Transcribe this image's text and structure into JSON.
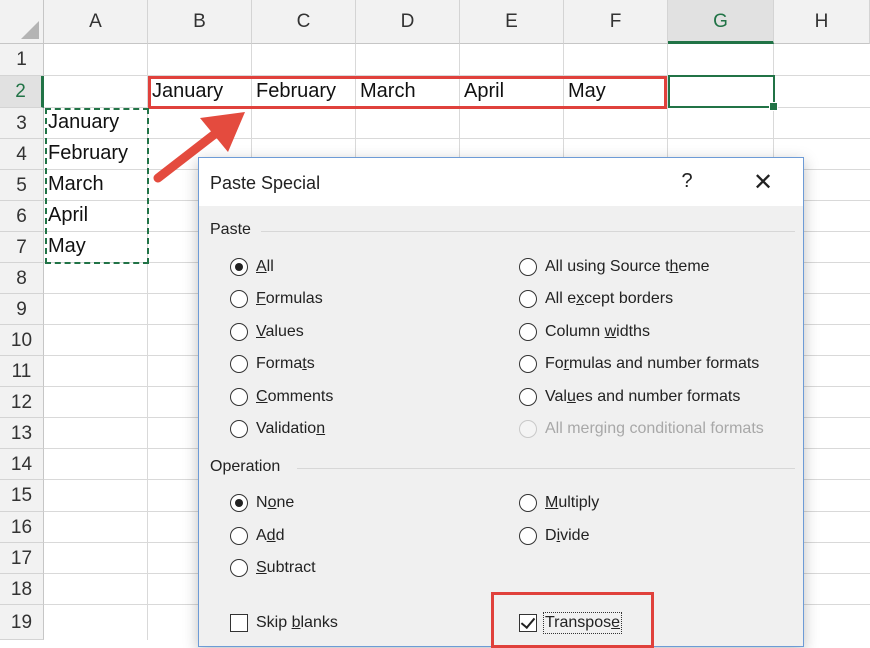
{
  "sheet": {
    "columns": [
      "A",
      "B",
      "C",
      "D",
      "E",
      "F",
      "G",
      "H"
    ],
    "rows": [
      "1",
      "2",
      "3",
      "4",
      "5",
      "6",
      "7",
      "8",
      "9",
      "10",
      "11",
      "12",
      "13",
      "14",
      "15",
      "16",
      "17",
      "18",
      "19"
    ],
    "selected_column": "G",
    "selected_row": "2",
    "row2_cells": [
      "January",
      "February",
      "March",
      "April",
      "May"
    ],
    "columnA_cells": [
      "January",
      "February",
      "March",
      "April",
      "May"
    ],
    "colors": {
      "accent_green": "#217346",
      "highlight_red": "#e0413c",
      "arrow_red": "#e44b3e"
    }
  },
  "dialog": {
    "title": "Paste Special",
    "help_label": "?",
    "close_label": "✕",
    "paste_section": "Paste",
    "paste_left": [
      {
        "pre": "",
        "u": "A",
        "post": "ll",
        "checked": true
      },
      {
        "pre": "",
        "u": "F",
        "post": "ormulas",
        "checked": false
      },
      {
        "pre": "",
        "u": "V",
        "post": "alues",
        "checked": false
      },
      {
        "pre": "Forma",
        "u": "t",
        "post": "s",
        "checked": false
      },
      {
        "pre": "",
        "u": "C",
        "post": "omments",
        "checked": false
      },
      {
        "pre": "Validatio",
        "u": "n",
        "post": "",
        "checked": false
      }
    ],
    "paste_right": [
      {
        "pre": "All using Source t",
        "u": "h",
        "post": "eme",
        "disabled": false
      },
      {
        "pre": "All e",
        "u": "x",
        "post": "cept borders",
        "disabled": false
      },
      {
        "pre": "Column ",
        "u": "w",
        "post": "idths",
        "disabled": false
      },
      {
        "pre": "Fo",
        "u": "r",
        "post": "mulas and number formats",
        "disabled": false
      },
      {
        "pre": "Val",
        "u": "u",
        "post": "es and number formats",
        "disabled": false
      },
      {
        "pre": "All merging conditional formats",
        "u": "",
        "post": "",
        "disabled": true
      }
    ],
    "operation_section": "Operation",
    "operation_left": [
      {
        "pre": "N",
        "u": "o",
        "post": "ne",
        "checked": true
      },
      {
        "pre": "A",
        "u": "d",
        "post": "d",
        "checked": false
      },
      {
        "pre": "",
        "u": "S",
        "post": "ubtract",
        "checked": false
      }
    ],
    "operation_right": [
      {
        "pre": "",
        "u": "M",
        "post": "ultiply",
        "checked": false
      },
      {
        "pre": "D",
        "u": "i",
        "post": "vide",
        "checked": false
      }
    ],
    "skip_blanks": {
      "pre": "Skip ",
      "u": "b",
      "post": "lanks",
      "checked": false
    },
    "transpose": {
      "pre": "Transpos",
      "u": "e",
      "post": "",
      "checked": true
    }
  }
}
